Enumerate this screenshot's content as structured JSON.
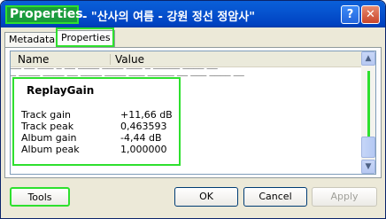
{
  "window": {
    "title_prefix": "Properties",
    "title_rest": "- \"산사의 여름 - 강원 정선 정암사\"",
    "help_glyph": "?",
    "close_glyph": "✕"
  },
  "tabs": [
    {
      "label": "Metadata",
      "active": false
    },
    {
      "label": "Properties",
      "active": true
    }
  ],
  "list": {
    "columns": [
      "Name",
      "Value"
    ],
    "garbled_rows": [
      "── ── ─── ─ ── ──── ──── ─── ─ ───── ──── ──",
      "─ ──── ──── ── ──── ──── ─── ───── ── ─── ──── ──"
    ]
  },
  "replaygain": {
    "heading": "ReplayGain",
    "rows": [
      {
        "key": "Track gain",
        "value": "+11,66 dB"
      },
      {
        "key": "Track peak",
        "value": "0,463593"
      },
      {
        "key": "Album gain",
        "value": "-4,44 dB"
      },
      {
        "key": "Album peak",
        "value": "1,000000"
      }
    ]
  },
  "buttons": {
    "tools": "Tools",
    "ok": "OK",
    "cancel": "Cancel",
    "apply": "Apply"
  },
  "colors": {
    "highlight": "#2ee02e",
    "titlebar": "#0054e3"
  }
}
